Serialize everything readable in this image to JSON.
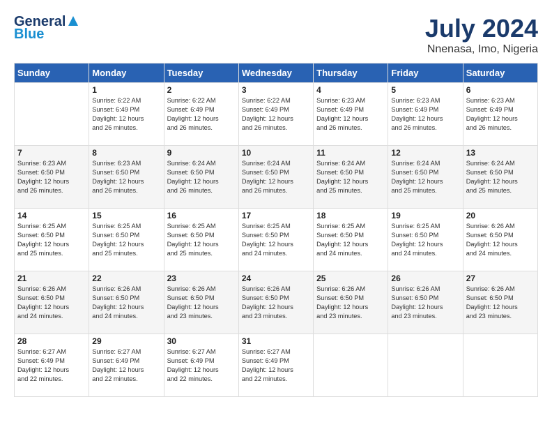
{
  "header": {
    "logo_general": "General",
    "logo_blue": "Blue",
    "title": "July 2024",
    "location": "Nnenasa, Imo, Nigeria"
  },
  "days_of_week": [
    "Sunday",
    "Monday",
    "Tuesday",
    "Wednesday",
    "Thursday",
    "Friday",
    "Saturday"
  ],
  "weeks": [
    [
      {
        "day": "",
        "info": ""
      },
      {
        "day": "1",
        "info": "Sunrise: 6:22 AM\nSunset: 6:49 PM\nDaylight: 12 hours\nand 26 minutes."
      },
      {
        "day": "2",
        "info": "Sunrise: 6:22 AM\nSunset: 6:49 PM\nDaylight: 12 hours\nand 26 minutes."
      },
      {
        "day": "3",
        "info": "Sunrise: 6:22 AM\nSunset: 6:49 PM\nDaylight: 12 hours\nand 26 minutes."
      },
      {
        "day": "4",
        "info": "Sunrise: 6:23 AM\nSunset: 6:49 PM\nDaylight: 12 hours\nand 26 minutes."
      },
      {
        "day": "5",
        "info": "Sunrise: 6:23 AM\nSunset: 6:49 PM\nDaylight: 12 hours\nand 26 minutes."
      },
      {
        "day": "6",
        "info": "Sunrise: 6:23 AM\nSunset: 6:49 PM\nDaylight: 12 hours\nand 26 minutes."
      }
    ],
    [
      {
        "day": "7",
        "info": "Sunrise: 6:23 AM\nSunset: 6:50 PM\nDaylight: 12 hours\nand 26 minutes."
      },
      {
        "day": "8",
        "info": "Sunrise: 6:23 AM\nSunset: 6:50 PM\nDaylight: 12 hours\nand 26 minutes."
      },
      {
        "day": "9",
        "info": "Sunrise: 6:24 AM\nSunset: 6:50 PM\nDaylight: 12 hours\nand 26 minutes."
      },
      {
        "day": "10",
        "info": "Sunrise: 6:24 AM\nSunset: 6:50 PM\nDaylight: 12 hours\nand 26 minutes."
      },
      {
        "day": "11",
        "info": "Sunrise: 6:24 AM\nSunset: 6:50 PM\nDaylight: 12 hours\nand 25 minutes."
      },
      {
        "day": "12",
        "info": "Sunrise: 6:24 AM\nSunset: 6:50 PM\nDaylight: 12 hours\nand 25 minutes."
      },
      {
        "day": "13",
        "info": "Sunrise: 6:24 AM\nSunset: 6:50 PM\nDaylight: 12 hours\nand 25 minutes."
      }
    ],
    [
      {
        "day": "14",
        "info": "Sunrise: 6:25 AM\nSunset: 6:50 PM\nDaylight: 12 hours\nand 25 minutes."
      },
      {
        "day": "15",
        "info": "Sunrise: 6:25 AM\nSunset: 6:50 PM\nDaylight: 12 hours\nand 25 minutes."
      },
      {
        "day": "16",
        "info": "Sunrise: 6:25 AM\nSunset: 6:50 PM\nDaylight: 12 hours\nand 25 minutes."
      },
      {
        "day": "17",
        "info": "Sunrise: 6:25 AM\nSunset: 6:50 PM\nDaylight: 12 hours\nand 24 minutes."
      },
      {
        "day": "18",
        "info": "Sunrise: 6:25 AM\nSunset: 6:50 PM\nDaylight: 12 hours\nand 24 minutes."
      },
      {
        "day": "19",
        "info": "Sunrise: 6:25 AM\nSunset: 6:50 PM\nDaylight: 12 hours\nand 24 minutes."
      },
      {
        "day": "20",
        "info": "Sunrise: 6:26 AM\nSunset: 6:50 PM\nDaylight: 12 hours\nand 24 minutes."
      }
    ],
    [
      {
        "day": "21",
        "info": "Sunrise: 6:26 AM\nSunset: 6:50 PM\nDaylight: 12 hours\nand 24 minutes."
      },
      {
        "day": "22",
        "info": "Sunrise: 6:26 AM\nSunset: 6:50 PM\nDaylight: 12 hours\nand 24 minutes."
      },
      {
        "day": "23",
        "info": "Sunrise: 6:26 AM\nSunset: 6:50 PM\nDaylight: 12 hours\nand 23 minutes."
      },
      {
        "day": "24",
        "info": "Sunrise: 6:26 AM\nSunset: 6:50 PM\nDaylight: 12 hours\nand 23 minutes."
      },
      {
        "day": "25",
        "info": "Sunrise: 6:26 AM\nSunset: 6:50 PM\nDaylight: 12 hours\nand 23 minutes."
      },
      {
        "day": "26",
        "info": "Sunrise: 6:26 AM\nSunset: 6:50 PM\nDaylight: 12 hours\nand 23 minutes."
      },
      {
        "day": "27",
        "info": "Sunrise: 6:26 AM\nSunset: 6:50 PM\nDaylight: 12 hours\nand 23 minutes."
      }
    ],
    [
      {
        "day": "28",
        "info": "Sunrise: 6:27 AM\nSunset: 6:49 PM\nDaylight: 12 hours\nand 22 minutes."
      },
      {
        "day": "29",
        "info": "Sunrise: 6:27 AM\nSunset: 6:49 PM\nDaylight: 12 hours\nand 22 minutes."
      },
      {
        "day": "30",
        "info": "Sunrise: 6:27 AM\nSunset: 6:49 PM\nDaylight: 12 hours\nand 22 minutes."
      },
      {
        "day": "31",
        "info": "Sunrise: 6:27 AM\nSunset: 6:49 PM\nDaylight: 12 hours\nand 22 minutes."
      },
      {
        "day": "",
        "info": ""
      },
      {
        "day": "",
        "info": ""
      },
      {
        "day": "",
        "info": ""
      }
    ]
  ]
}
